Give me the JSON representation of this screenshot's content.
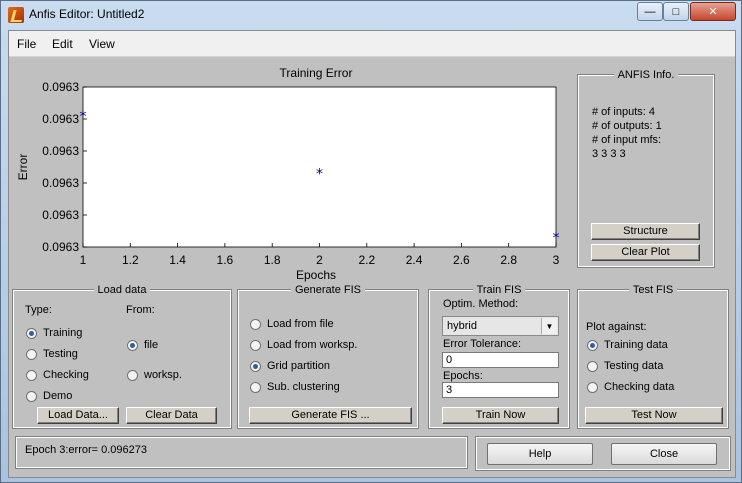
{
  "window": {
    "title": "Anfis Editor: Untitled2",
    "min_icon": "minimize-icon",
    "max_icon": "maximize-icon",
    "close_icon": "close-icon",
    "close_glyph": "✕"
  },
  "menu": {
    "items": [
      "File",
      "Edit",
      "View"
    ]
  },
  "chart_data": {
    "type": "scatter",
    "title": "Training Error",
    "xlabel": "Epochs",
    "ylabel": "Error",
    "xlim": [
      1,
      3
    ],
    "x_ticks": [
      "1",
      "1.2",
      "1.4",
      "1.6",
      "1.8",
      "2",
      "2.2",
      "2.4",
      "2.6",
      "2.8",
      "3"
    ],
    "y_ticks": [
      "0.0963",
      "0.0963",
      "0.0963",
      "0.0963",
      "0.0963",
      "0.0963"
    ],
    "ylim": [
      0.09627,
      0.09632
    ],
    "points": [
      {
        "x": 1,
        "y": 0.096311
      },
      {
        "x": 2,
        "y": 0.096293
      },
      {
        "x": 3,
        "y": 0.096273
      }
    ],
    "marker": "*",
    "color": "#00008b"
  },
  "anfis_info": {
    "title": "ANFIS Info.",
    "lines": [
      "# of inputs: 4",
      "# of outputs: 1",
      "# of input mfs:",
      "3  3  3  3"
    ],
    "structure_button": "Structure",
    "clear_plot_button": "Clear Plot"
  },
  "load_data": {
    "title": "Load data",
    "type_label": "Type:",
    "from_label": "From:",
    "types": [
      {
        "label": "Training",
        "checked": true
      },
      {
        "label": "Testing",
        "checked": false
      },
      {
        "label": "Checking",
        "checked": false
      },
      {
        "label": "Demo",
        "checked": false
      }
    ],
    "sources": [
      {
        "label": "file",
        "checked": true
      },
      {
        "label": "worksp.",
        "checked": false
      }
    ],
    "load_button": "Load Data...",
    "clear_button": "Clear Data"
  },
  "generate_fis": {
    "title": "Generate FIS",
    "options": [
      {
        "label": "Load from file",
        "checked": false
      },
      {
        "label": "Load from worksp.",
        "checked": false
      },
      {
        "label": "Grid partition",
        "checked": true
      },
      {
        "label": "Sub. clustering",
        "checked": false
      }
    ],
    "button": "Generate FIS ..."
  },
  "train_fis": {
    "title": "Train FIS",
    "method_label": "Optim. Method:",
    "method_value": "hybrid",
    "tolerance_label": "Error Tolerance:",
    "tolerance_value": "0",
    "epochs_label": "Epochs:",
    "epochs_value": "3",
    "button": "Train Now"
  },
  "test_fis": {
    "title": "Test FIS",
    "plot_against_label": "Plot against:",
    "options": [
      {
        "label": "Training data",
        "checked": true
      },
      {
        "label": "Testing data",
        "checked": false
      },
      {
        "label": "Checking data",
        "checked": false
      }
    ],
    "button": "Test Now"
  },
  "status": {
    "text": "Epoch 3:error= 0.096273"
  },
  "footer": {
    "help_button": "Help",
    "close_button": "Close"
  }
}
